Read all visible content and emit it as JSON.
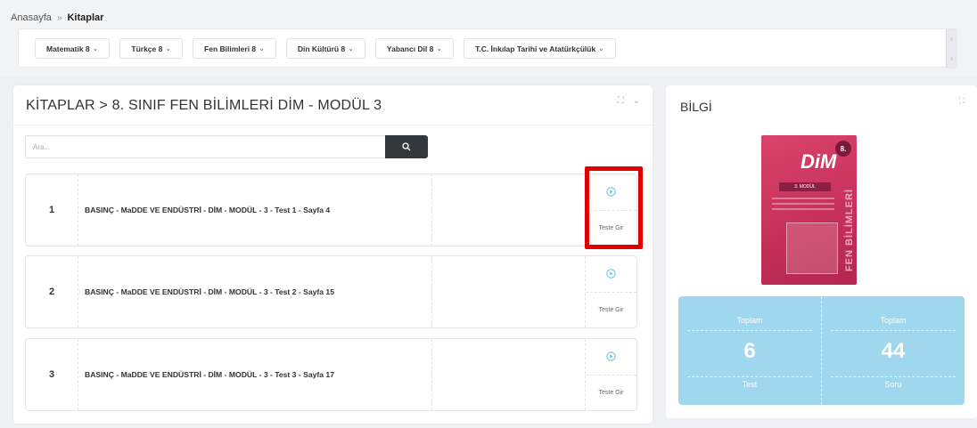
{
  "breadcrumb": {
    "home": "Anasayfa",
    "separator": "»",
    "current": "Kitaplar"
  },
  "subjects": [
    {
      "label": "Matematik 8"
    },
    {
      "label": "Türkçe 8"
    },
    {
      "label": "Fen Bilimleri 8"
    },
    {
      "label": "Din Kültürü 8"
    },
    {
      "label": "Yabancı Dil 8"
    },
    {
      "label": "T.C. İnkılap Tarihi ve Atatürkçülük"
    }
  ],
  "books_panel": {
    "title": "KİTAPLAR > 8. SINIF FEN BİLİMLERİ DİM - MODÜL 3",
    "search_placeholder": "Ara..."
  },
  "tests": [
    {
      "number": "1",
      "name": "BASINÇ - MaDDE VE ENDÜSTRİ - DİM - MODÜL - 3 - Test 1 - Sayfa 4",
      "action": "Teste Gir"
    },
    {
      "number": "2",
      "name": "BASINÇ - MaDDE VE ENDÜSTRİ - DİM - MODÜL - 3 - Test 2 - Sayfa 15",
      "action": "Teste Gir"
    },
    {
      "number": "3",
      "name": "BASINÇ - MaDDE VE ENDÜSTRİ - DİM - MODÜL - 3 - Test 3 - Sayfa 17",
      "action": "Teste Gir"
    }
  ],
  "info_panel": {
    "title": "BİLGİ",
    "cover": {
      "logo": "DiM",
      "grade": "8.",
      "module": "3. MODÜL",
      "subject": "FEN BİLİMLERİ"
    },
    "stats": [
      {
        "label": "Toplam",
        "value": "6",
        "unit": "Test"
      },
      {
        "label": "Toplam",
        "value": "44",
        "unit": "Soru"
      }
    ]
  },
  "colors": {
    "accent_play": "#5bc0de",
    "stats_bg": "#9fd7ee",
    "search_button": "#34383d",
    "highlight": "#e00000"
  }
}
